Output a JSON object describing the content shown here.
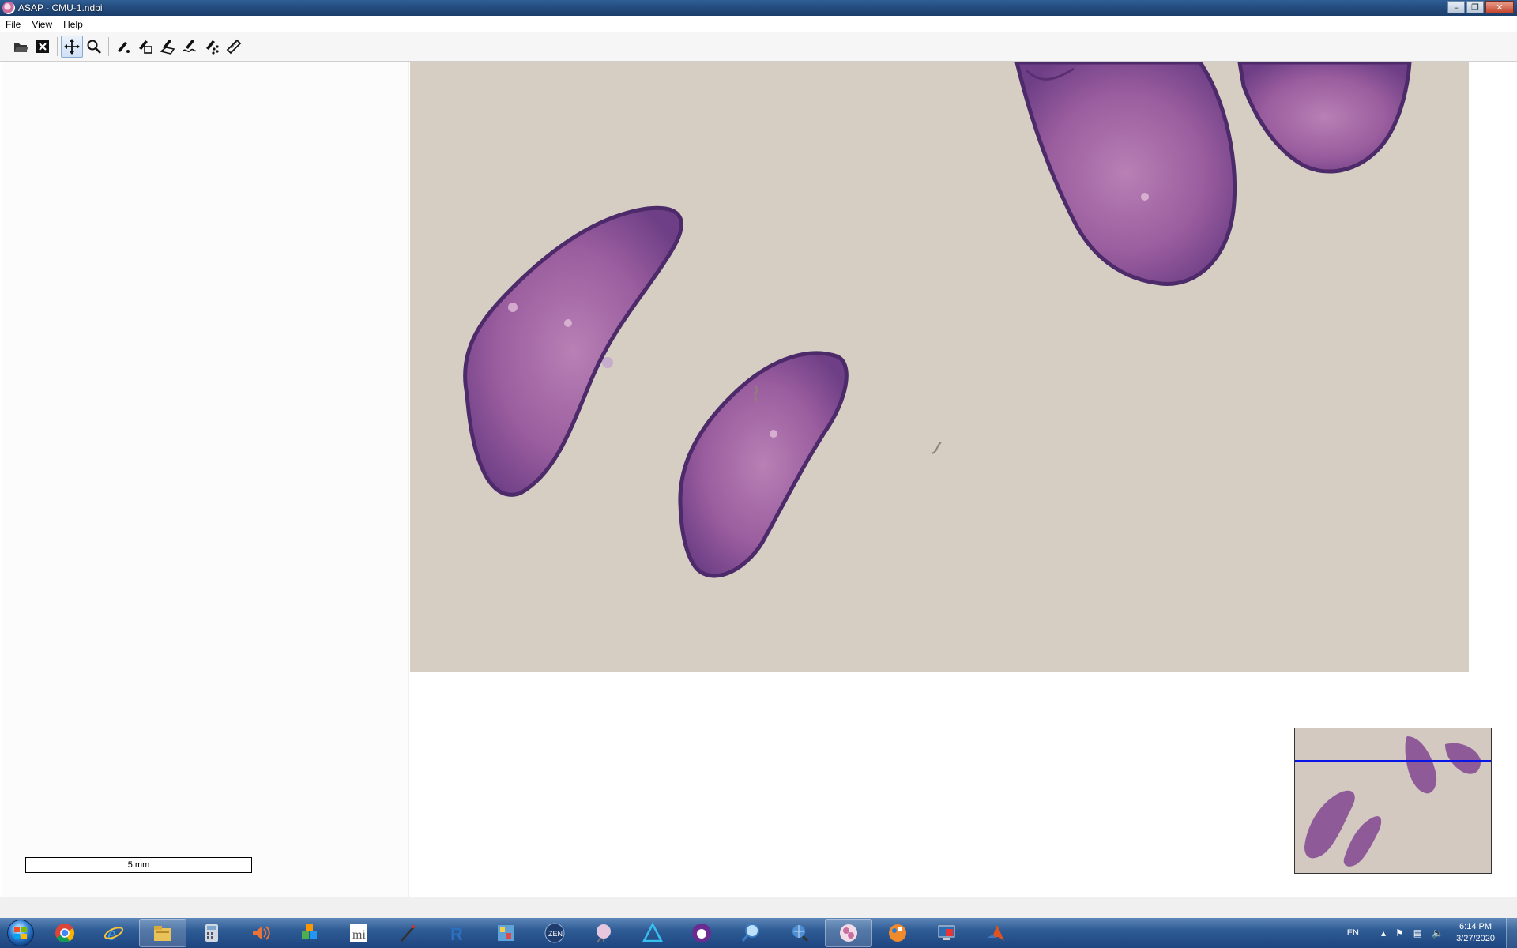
{
  "window": {
    "title": "ASAP - CMU-1.ndpi",
    "controls": [
      "minimize",
      "maximize",
      "close"
    ]
  },
  "menu": {
    "items": [
      "File",
      "View",
      "Help"
    ]
  },
  "toolbar": {
    "tools": [
      "open-icon",
      "close-file-icon",
      "pan-icon",
      "zoom-icon",
      "dot-annotation-icon",
      "rectangle-annotation-icon",
      "polygon-annotation-icon",
      "spline-annotation-icon",
      "pointset-annotation-icon",
      "ruler-icon"
    ],
    "active_tool": "pan-icon"
  },
  "viewer": {
    "scale_bar_label": "5 mm",
    "background_color": "#d6cdc3",
    "overview_viewport_color": "#0a16e8"
  },
  "taskbar": {
    "apps": [
      "chrome-icon",
      "internet-explorer-icon",
      "file-explorer-icon",
      "calculator-icon",
      "volume-app-icon",
      "cubes-app-icon",
      "mu-app-icon",
      "pen-app-icon",
      "r-icon",
      "image-app-icon",
      "zen-icon",
      "slide-app-icon",
      "triangle-app-icon",
      "purple-app-icon",
      "magnifier-app-icon",
      "globe-search-icon",
      "asap-icon",
      "paint-app-icon",
      "monitor-app-icon",
      "matlab-icon"
    ],
    "active_app": "asap-icon",
    "tray": {
      "language": "EN",
      "time": "6:14 PM",
      "date": "3/27/2020"
    }
  }
}
